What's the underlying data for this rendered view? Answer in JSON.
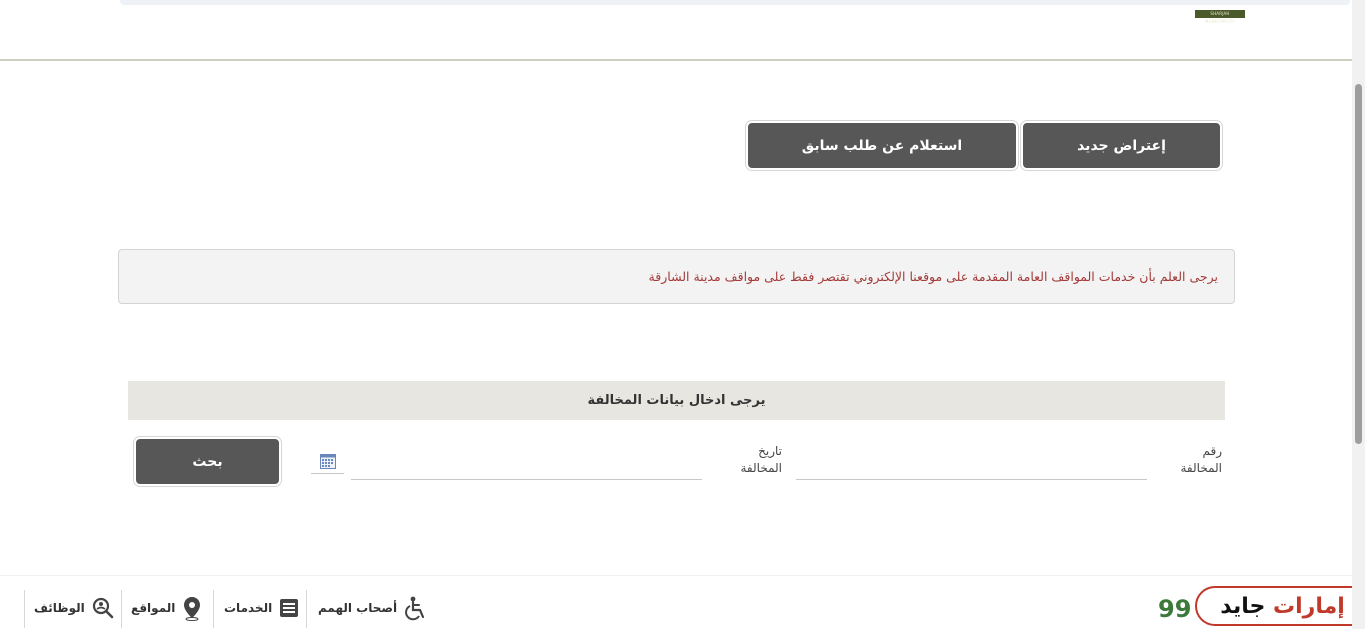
{
  "header": {
    "logo_text": "SHARJAH MUNICIPALITY"
  },
  "actions": {
    "new_objection": "إعتراض جديد",
    "inquiry_previous": "استعلام عن طلب سابق"
  },
  "notice": {
    "text": "يرجى العلم بأن خدمات المواقف العامة المقدمة على موقعنا الإلكتروني تقتصر فقط على مواقف مدينة الشارقة"
  },
  "form": {
    "title": "يرجى ادخال بيانات المخالفة",
    "number_label_line1": "رقم",
    "number_label_line2": "المخالفة",
    "date_label_line1": "تاريخ",
    "date_label_line2": "المخالفة",
    "number_value": "",
    "date_value": "",
    "search_button": "بحث"
  },
  "footer": {
    "items": [
      {
        "label": "أصحاب الهمم",
        "icon": "wheelchair-icon"
      },
      {
        "label": "الخدمات",
        "icon": "list-icon"
      },
      {
        "label": "المواقع",
        "icon": "location-pin-icon"
      },
      {
        "label": "الوظائف",
        "icon": "search-people-icon"
      }
    ],
    "number_partial": "99",
    "brand_part1": "إمارات",
    "brand_part2": "جايد"
  },
  "colors": {
    "button_bg": "#575757",
    "notice_text": "#a33a3a",
    "form_head_bg": "#e8e6e0",
    "brand_red": "#c0392b"
  }
}
